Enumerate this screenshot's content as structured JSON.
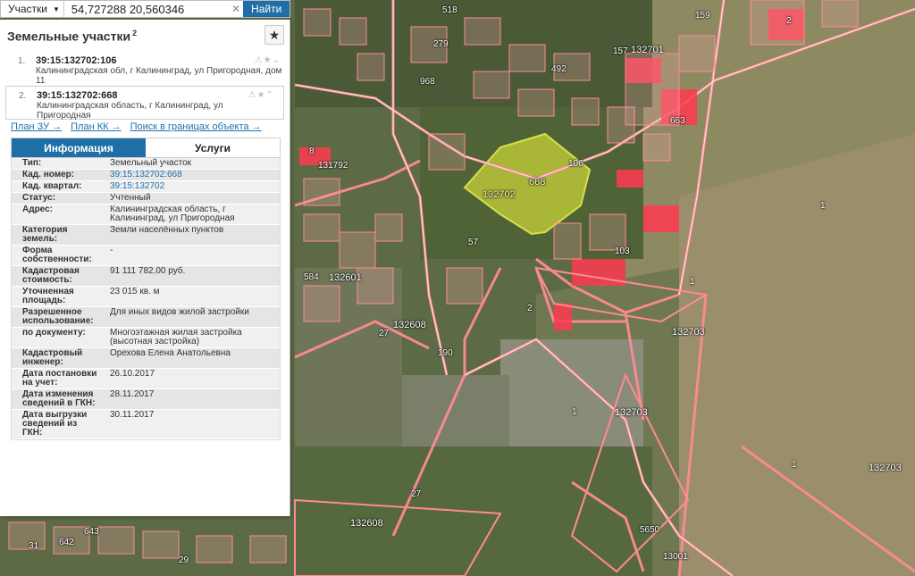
{
  "search": {
    "type_label": "Участки",
    "query": "54,727288 20,560346",
    "clear_icon": "clear-icon",
    "button_label": "Найти"
  },
  "panel": {
    "title": "Земельные участки",
    "count": "2",
    "favorite_icon": "star-icon"
  },
  "results": [
    {
      "num": "1.",
      "cad": "39:15:132702:106",
      "address": "Калининградская обл, г Калининград, ул Пригородная, дом 11",
      "tools": "⚠★⌄"
    },
    {
      "num": "2.",
      "cad": "39:15:132702:668",
      "address": "Калининградская область, г Калининград, ул Пригородная",
      "tools": "⚠★⌃"
    }
  ],
  "links": {
    "plan_zu": "План ЗУ →",
    "plan_kk": "План КК →",
    "search_bounds": "Поиск в границах объекта →"
  },
  "tabs": {
    "info": "Информация",
    "services": "Услуги"
  },
  "info_rows": [
    {
      "key": "Тип:",
      "value": "Земельный участок"
    },
    {
      "key": "Кад. номер:",
      "value": "39:15:132702:668"
    },
    {
      "key": "Кад. квартал:",
      "value": "39:15:132702"
    },
    {
      "key": "Статус:",
      "value": "Учтенный"
    },
    {
      "key": "Адрес:",
      "value": "Калининградская область, г Калининград, ул Пригородная"
    },
    {
      "key": "Категория земель:",
      "value": "Земли населённых пунктов"
    },
    {
      "key": "Форма собственности:",
      "value": "-"
    },
    {
      "key": "Кадастровая стоимость:",
      "value": "91 111 782,00 руб."
    },
    {
      "key": "Уточненная площадь:",
      "value": "23 015 кв. м"
    },
    {
      "key": "Разрешенное использование:",
      "value": "Для иных видов жилой застройки"
    },
    {
      "key": "по документу:",
      "value": "Многоэтажная жилая застройка (высотная застройка)"
    },
    {
      "key": "Кадастровый инженер:",
      "value": "Орехова Елена Анатольевна"
    },
    {
      "key": "Дата постановки на учет:",
      "value": "26.10.2017"
    },
    {
      "key": "Дата изменения сведений в ГКН:",
      "value": "28.11.2017"
    },
    {
      "key": "Дата выгрузки сведений из ГКН:",
      "value": "30.11.2017"
    }
  ],
  "map": {
    "labels": [
      "518",
      "279",
      "968",
      "492",
      "157",
      "159",
      "2",
      "132701",
      "663",
      "106",
      "668",
      "132702",
      "1",
      "103",
      "1",
      "132703",
      "1",
      "132703",
      "1",
      "132703",
      "132601",
      "584",
      "132608",
      "132608",
      "27",
      "27",
      "190",
      "2",
      "57",
      "131792",
      "8",
      "29",
      "31",
      "642",
      "643",
      "5650",
      "13001"
    ],
    "colors": {
      "boundary": "#ff8a94",
      "boundary_fill": "#f7a9b1",
      "selected": "#c8d23a",
      "building": "#ff3a4f",
      "field": "#9a8f6a"
    }
  }
}
